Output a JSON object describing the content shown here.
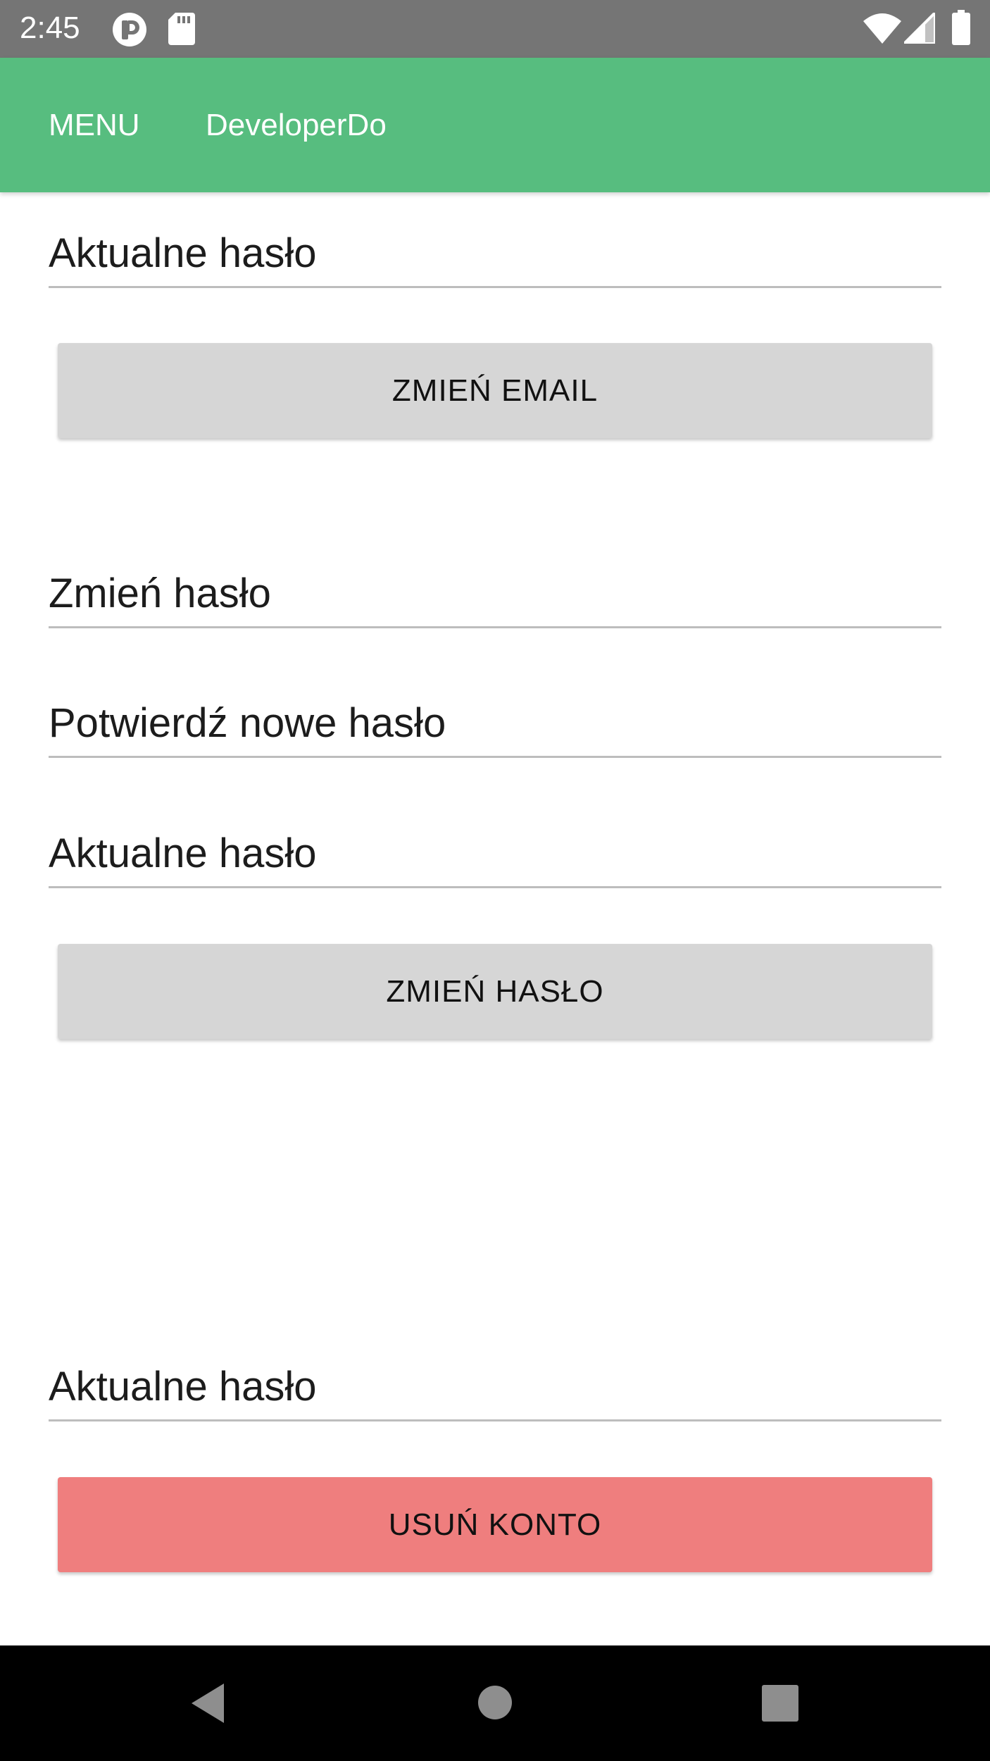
{
  "status_bar": {
    "time": "2:45",
    "icons": [
      "notification-icon",
      "sd-card-icon",
      "wifi-icon",
      "signal-icon",
      "battery-icon"
    ]
  },
  "app_bar": {
    "menu_label": "MENU",
    "title": "DeveloperDo",
    "background": "#57bd7f"
  },
  "email_section": {
    "current_password_placeholder": "Aktualne hasło",
    "button_label": "ZMIEŃ EMAIL"
  },
  "password_section": {
    "new_password_placeholder": "Zmień hasło",
    "confirm_password_placeholder": "Potwierdź nowe hasło",
    "current_password_placeholder": "Aktualne hasło",
    "button_label": "ZMIEŃ HASŁO"
  },
  "delete_section": {
    "current_password_placeholder": "Aktualne hasło",
    "button_label": "USUŃ KONTO",
    "button_color": "#ef7e7e"
  },
  "nav_bar": {
    "buttons": [
      "back-icon",
      "home-icon",
      "recents-icon"
    ]
  }
}
